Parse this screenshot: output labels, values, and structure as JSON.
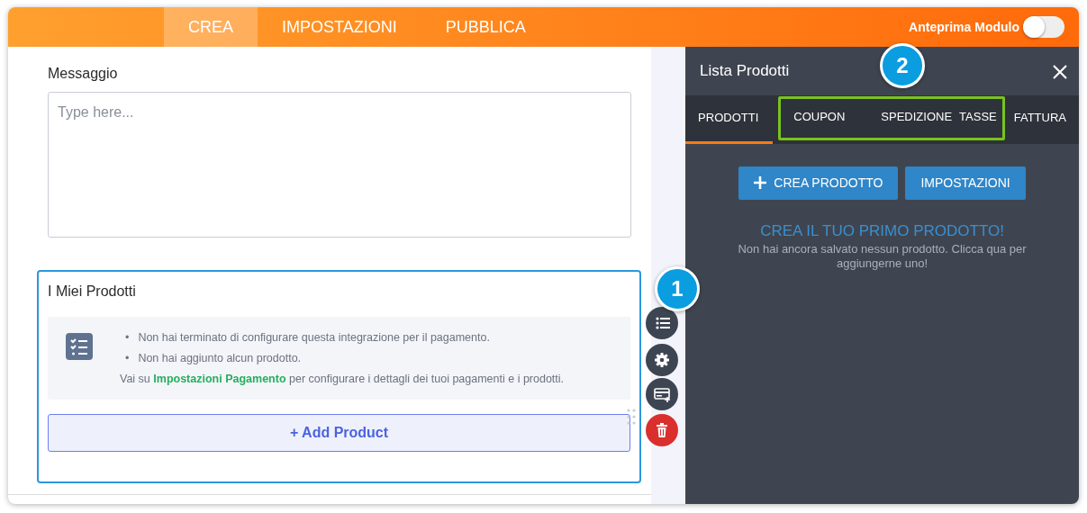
{
  "header": {
    "tabs": [
      {
        "label": "CREA",
        "selected": true
      },
      {
        "label": "IMPOSTAZIONI",
        "selected": false
      },
      {
        "label": "PUBBLICA",
        "selected": false
      }
    ],
    "preview_toggle": {
      "label": "Anteprima Modulo",
      "on": false
    }
  },
  "form": {
    "message_field": {
      "label": "Messaggio",
      "placeholder": "Type here..."
    },
    "products_block": {
      "title": "I Miei Prodotti",
      "notice_items": [
        {
          "bullet": "•",
          "text": "Non hai terminato di configurare questa integrazione per il pagamento."
        },
        {
          "bullet": "•",
          "text": "Non hai aggiunto alcun prodotto."
        }
      ],
      "notice_text": "Vai su **Impostazioni Pagamento** per configurare i dettagli dei tuoi pagamenti e i prodotti.",
      "add_button": "+ Add Product"
    },
    "actions": [
      {
        "kind": "list"
      },
      {
        "kind": "settings"
      },
      {
        "kind": "payment"
      },
      {
        "kind": "delete"
      }
    ]
  },
  "panel": {
    "title": "Lista Prodotti",
    "tabs": [
      {
        "label": "PRODOTTI",
        "selected": true,
        "highlighted": false
      },
      {
        "label": "COUPON",
        "selected": false,
        "highlighted": true
      },
      {
        "label": "SPEDIZIONE",
        "selected": false,
        "highlighted": true
      },
      {
        "label": "TASSE",
        "selected": false,
        "highlighted": true
      },
      {
        "label": "FATTURA",
        "selected": false,
        "highlighted": false
      }
    ],
    "buttons": [
      {
        "label": "CREA PRODOTTO",
        "kind": "add"
      },
      {
        "label": "IMPOSTAZIONI",
        "kind": "plain"
      }
    ],
    "empty_title": "CREA IL TUO PRIMO PRODOTTO!",
    "empty_text": "Non hai ancora salvato nessun prodotto. Clicca qua per aggiungerne uno!"
  },
  "annotations": [
    {
      "label": "1"
    },
    {
      "label": "2"
    }
  ]
}
